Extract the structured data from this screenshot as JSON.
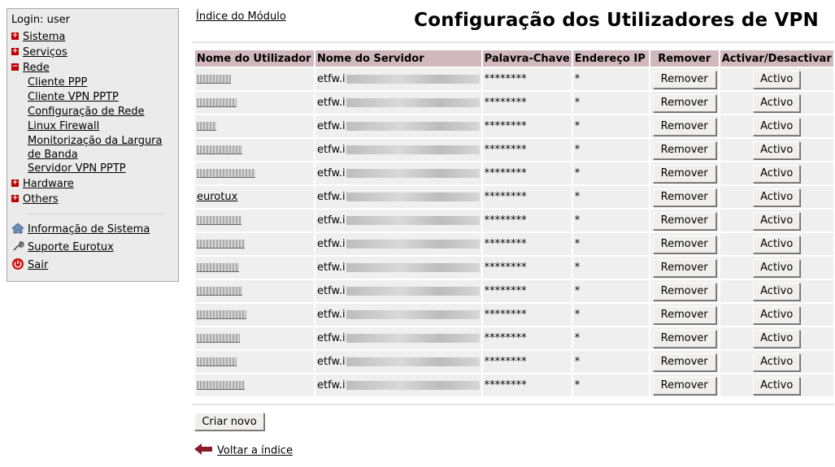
{
  "sidebar": {
    "login": "Login: user",
    "items": [
      {
        "label": "Sistema",
        "state": "+"
      },
      {
        "label": "Serviços",
        "state": "+"
      },
      {
        "label": "Rede",
        "state": "−"
      }
    ],
    "rede_sub": [
      "Cliente PPP",
      "Cliente VPN PPTP",
      "Configuração de Rede",
      "Linux Firewall",
      "Monitorização da Largura de Banda",
      "Servidor VPN PPTP"
    ],
    "items_after": [
      {
        "label": "Hardware",
        "state": "+"
      },
      {
        "label": "Others",
        "state": "+"
      }
    ],
    "utils": [
      {
        "label": "Informação de Sistema",
        "icon": "home-icon"
      },
      {
        "label": "Suporte Eurotux",
        "icon": "wrench-icon"
      },
      {
        "label": "Sair",
        "icon": "power-icon"
      }
    ]
  },
  "header": {
    "index_link": "Índice do Módulo",
    "title": "Configuração dos Utilizadores de VPN"
  },
  "table": {
    "columns": [
      "Nome do Utilizador",
      "Nome do Servidor",
      "Palavra-Chave",
      "Endereço IP",
      "Remover",
      "Activar/Desactivar"
    ],
    "rows": [
      {
        "user": "",
        "server": "etfw.i",
        "password": "********",
        "ip": "*",
        "remove": "Remover",
        "toggle": "Activo"
      },
      {
        "user": "",
        "server": "etfw.i",
        "password": "********",
        "ip": "*",
        "remove": "Remover",
        "toggle": "Activo"
      },
      {
        "user": "",
        "server": "etfw.i",
        "password": "********",
        "ip": "*",
        "remove": "Remover",
        "toggle": "Activo"
      },
      {
        "user": "",
        "server": "etfw.i",
        "password": "********",
        "ip": "*",
        "remove": "Remover",
        "toggle": "Activo"
      },
      {
        "user": "",
        "server": "etfw.i",
        "password": "********",
        "ip": "*",
        "remove": "Remover",
        "toggle": "Activo"
      },
      {
        "user": "eurotux",
        "server": "etfw.i",
        "password": "********",
        "ip": "*",
        "remove": "Remover",
        "toggle": "Activo"
      },
      {
        "user": "",
        "server": "etfw.i",
        "password": "********",
        "ip": "*",
        "remove": "Remover",
        "toggle": "Activo"
      },
      {
        "user": "",
        "server": "etfw.i",
        "password": "********",
        "ip": "*",
        "remove": "Remover",
        "toggle": "Activo"
      },
      {
        "user": "",
        "server": "etfw.i",
        "password": "********",
        "ip": "*",
        "remove": "Remover",
        "toggle": "Activo"
      },
      {
        "user": "",
        "server": "etfw.i",
        "password": "********",
        "ip": "*",
        "remove": "Remover",
        "toggle": "Activo"
      },
      {
        "user": "",
        "server": "etfw.i",
        "password": "********",
        "ip": "*",
        "remove": "Remover",
        "toggle": "Activo"
      },
      {
        "user": "",
        "server": "etfw.i",
        "password": "********",
        "ip": "*",
        "remove": "Remover",
        "toggle": "Activo"
      },
      {
        "user": "",
        "server": "etfw.i",
        "password": "********",
        "ip": "*",
        "remove": "Remover",
        "toggle": "Activo"
      },
      {
        "user": "",
        "server": "etfw.i",
        "password": "********",
        "ip": "*",
        "remove": "Remover",
        "toggle": "Activo"
      }
    ]
  },
  "actions": {
    "create": "Criar novo",
    "back": "Voltar a índice"
  },
  "colors": {
    "header_bg": "#d0b8bc",
    "cell_bg": "#efefef",
    "sidebar_bg": "#ebebeb",
    "plus_icon": "#c00000",
    "back_arrow": "#8b1a2b"
  }
}
